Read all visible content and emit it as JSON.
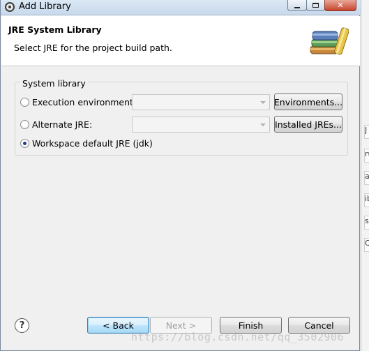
{
  "window": {
    "title": "Add Library"
  },
  "header": {
    "title": "JRE System Library",
    "description": "Select JRE for the project build path."
  },
  "system_library": {
    "group_label": "System library",
    "options": [
      {
        "label": "Execution environment:",
        "selected": false,
        "combo_value": "",
        "button": "Environments..."
      },
      {
        "label": "Alternate JRE:",
        "selected": false,
        "combo_value": "",
        "button": "Installed JREs..."
      },
      {
        "label": "Workspace default JRE (jdk)",
        "selected": true
      }
    ]
  },
  "footer": {
    "help_glyph": "?",
    "back_label": "< Back",
    "next_label": "Next >",
    "finish_label": "Finish",
    "cancel_label": "Cancel"
  },
  "background": {
    "fragments": [
      "J",
      "ru",
      "ar",
      "ib",
      "ss",
      "C"
    ]
  },
  "watermark": "https://blog.csdn.net/qq_3502906",
  "icons": {
    "title": "eclipse-icon",
    "header": "library-books-icon",
    "help": "help-icon"
  },
  "colors": {
    "window_bg": "#f0f0f0",
    "header_bg": "#ffffff",
    "default_button_border": "#3c7fb1",
    "close_button": "#c7452d"
  }
}
